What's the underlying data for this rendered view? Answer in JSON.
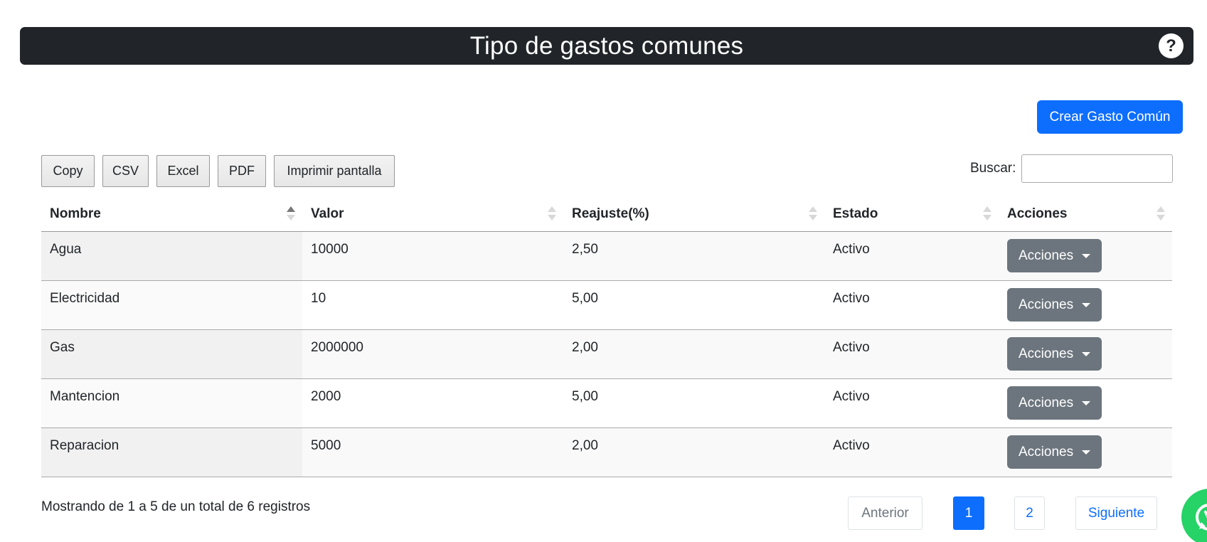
{
  "header": {
    "title": "Tipo de gastos comunes",
    "help_glyph": "?"
  },
  "actions": {
    "create_label": "Crear Gasto Común"
  },
  "export_buttons": [
    "Copy",
    "CSV",
    "Excel",
    "PDF",
    "Imprimir pantalla"
  ],
  "search": {
    "label": "Buscar:",
    "value": "",
    "placeholder": ""
  },
  "table": {
    "columns": [
      "Nombre",
      "Valor",
      "Reajuste(%)",
      "Estado",
      "Acciones"
    ],
    "sorted_column": "Nombre",
    "sort_direction": "asc",
    "rows": [
      {
        "nombre": "Agua",
        "valor": "10000",
        "reajuste": "2,50",
        "estado": "Activo",
        "acciones": "Acciones"
      },
      {
        "nombre": "Electricidad",
        "valor": "10",
        "reajuste": "5,00",
        "estado": "Activo",
        "acciones": "Acciones"
      },
      {
        "nombre": "Gas",
        "valor": "2000000",
        "reajuste": "2,00",
        "estado": "Activo",
        "acciones": "Acciones"
      },
      {
        "nombre": "Mantencion",
        "valor": "2000",
        "reajuste": "5,00",
        "estado": "Activo",
        "acciones": "Acciones"
      },
      {
        "nombre": "Reparacion",
        "valor": "5000",
        "reajuste": "2,00",
        "estado": "Activo",
        "acciones": "Acciones"
      }
    ]
  },
  "footer": {
    "info": "Mostrando de 1 a 5 de un total de 6 registros"
  },
  "pagination": {
    "previous": "Anterior",
    "pages": [
      "1",
      "2"
    ],
    "current_page": "1",
    "next": "Siguiente"
  },
  "colors": {
    "header_bg": "#212529",
    "primary": "#0d6efd",
    "secondary": "#6c757d",
    "whatsapp": "#25d366"
  },
  "icons": {
    "help": "question-circle-icon",
    "whatsapp": "whatsapp-icon",
    "dropdown": "caret-down-icon",
    "sort": "sort-arrows-icon"
  }
}
